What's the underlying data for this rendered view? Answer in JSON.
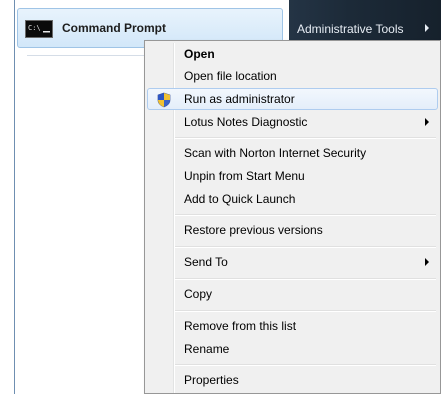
{
  "start_menu": {
    "pinned_item": {
      "label": "Command Prompt",
      "icon": "command-prompt-icon"
    },
    "right_pane": {
      "item_label": "Administrative Tools"
    }
  },
  "context_menu": {
    "items": [
      {
        "label": "Open",
        "bold": true
      },
      {
        "label": "Open file location"
      },
      {
        "label": "Run as administrator",
        "icon": "uac-shield-icon",
        "highlighted": true
      },
      {
        "label": "Lotus Notes Diagnostic",
        "has_submenu": true
      },
      {
        "label": "Scan with Norton Internet Security"
      },
      {
        "label": "Unpin from Start Menu"
      },
      {
        "label": "Add to Quick Launch"
      },
      {
        "label": "Restore previous versions"
      },
      {
        "label": "Send To",
        "has_submenu": true
      },
      {
        "label": "Copy"
      },
      {
        "label": "Remove from this list"
      },
      {
        "label": "Rename"
      },
      {
        "label": "Properties"
      }
    ]
  },
  "colors": {
    "highlight_border": "#aeccef",
    "menu_background": "#f0f0f0",
    "right_pane": "#1c2a38"
  }
}
